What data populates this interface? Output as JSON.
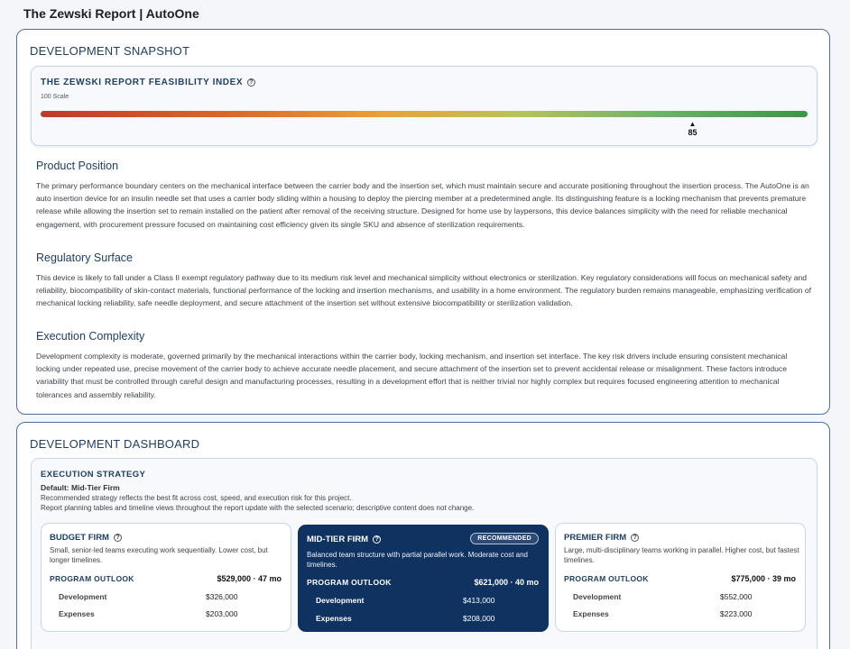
{
  "app": {
    "title": "The Zewski Report | AutoOne"
  },
  "snapshot": {
    "title": "DEVELOPMENT SNAPSHOT",
    "index": {
      "title": "THE ZEWSKI REPORT FEASIBILITY INDEX",
      "scale_label": "100 Scale",
      "value": 85,
      "value_text": "85",
      "max": 100,
      "marker": "▲"
    },
    "sections": [
      {
        "heading": "Product Position",
        "body": "The primary performance boundary centers on the mechanical interface between the carrier body and the insertion set, which must maintain secure and accurate positioning throughout the insertion process. The AutoOne is an auto insertion device for an insulin needle set that uses a carrier body sliding within a housing to deploy the piercing member at a predetermined angle. Its distinguishing feature is a locking mechanism that prevents premature release while allowing the insertion set to remain installed on the patient after removal of the receiving structure. Designed for home use by laypersons, this device balances simplicity with the need for reliable mechanical engagement, with procurement pressure focused on maintaining cost efficiency given its single SKU and absence of sterilization requirements."
      },
      {
        "heading": "Regulatory Surface",
        "body": "This device is likely to fall under a Class II exempt regulatory pathway due to its medium risk level and mechanical simplicity without electronics or sterilization. Key regulatory considerations will focus on mechanical safety and reliability, biocompatibility of skin-contact materials, functional performance of the locking and insertion mechanisms, and usability in a home environment. The regulatory burden remains manageable, emphasizing verification of mechanical locking reliability, safe needle deployment, and secure attachment of the insertion set without extensive biocompatibility or sterilization validation."
      },
      {
        "heading": "Execution Complexity",
        "body": "Development complexity is moderate, governed primarily by the mechanical interactions within the carrier body, locking mechanism, and insertion set interface. The key risk drivers include ensuring consistent mechanical locking under repeated use, precise movement of the carrier body to achieve accurate needle placement, and secure attachment of the insertion set to prevent accidental release or misalignment. These factors introduce variability that must be controlled through careful design and manufacturing processes, resulting in a development effort that is neither trivial nor highly complex but requires focused engineering attention to mechanical tolerances and assembly reliability."
      }
    ]
  },
  "dashboard": {
    "title": "DEVELOPMENT DASHBOARD",
    "strategy": {
      "title": "EXECUTION STRATEGY",
      "default_label": "Default: Mid-Tier Firm",
      "note_1": "Recommended strategy reflects the best fit across cost, speed, and execution risk for this project.",
      "note_2": "Report planning tables and timeline views throughout the report update with the selected scenario; descriptive content does not change.",
      "tiers": [
        {
          "name": "BUDGET FIRM",
          "desc": "Small, senior-led teams executing work sequentially. Lower cost, but longer timelines.",
          "outlook_label": "PROGRAM OUTLOOK",
          "total": "$529,000 · 47 mo",
          "rows": [
            {
              "label": "Development",
              "value": "$326,000"
            },
            {
              "label": "Expenses",
              "value": "$203,000"
            }
          ]
        },
        {
          "name": "MID-TIER FIRM",
          "badge": "RECOMMENDED",
          "desc": "Balanced team structure with partial parallel work. Moderate cost and timelines.",
          "outlook_label": "PROGRAM OUTLOOK",
          "total": "$621,000 · 40 mo",
          "rows": [
            {
              "label": "Development",
              "value": "$413,000"
            },
            {
              "label": "Expenses",
              "value": "$208,000"
            }
          ]
        },
        {
          "name": "PREMIER FIRM",
          "desc": "Large, multi-disciplinary teams working in parallel. Higher cost, but fastest timelines.",
          "outlook_label": "PROGRAM OUTLOOK",
          "total": "$775,000 · 39 mo",
          "rows": [
            {
              "label": "Development",
              "value": "$552,000"
            },
            {
              "label": "Expenses",
              "value": "$223,000"
            }
          ]
        }
      ]
    }
  },
  "icons": {
    "help": "help-circle-icon",
    "help_glyph": "?"
  },
  "colors": {
    "brand": "#1f3f63",
    "recommended_bg": "#0f3260",
    "border": "#4f6f94"
  }
}
